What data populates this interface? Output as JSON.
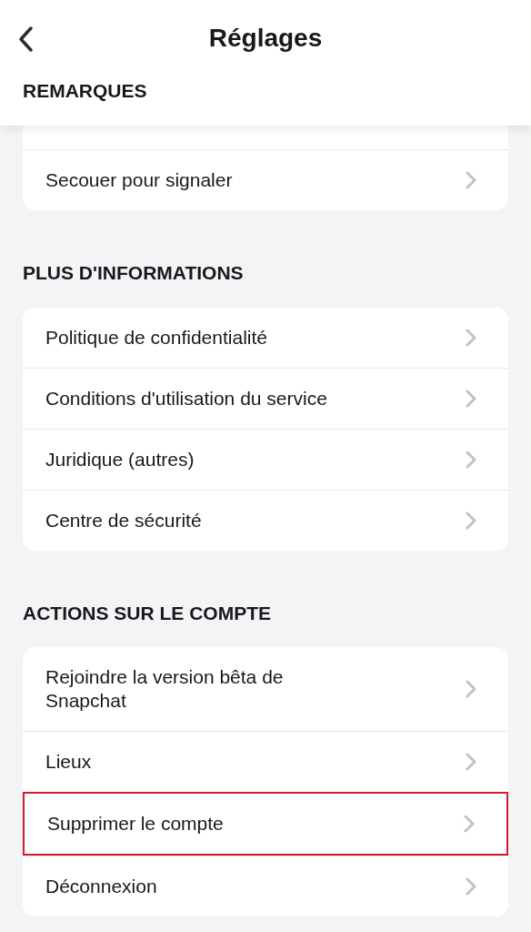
{
  "header": {
    "title": "Réglages"
  },
  "sections": [
    {
      "title": "REMARQUES",
      "rows": [
        {
          "label": "Secouer pour signaler",
          "highlighted": false
        }
      ]
    },
    {
      "title": "PLUS D'INFORMATIONS",
      "rows": [
        {
          "label": "Politique de confidentialité",
          "highlighted": false
        },
        {
          "label": "Conditions d'utilisation du service",
          "highlighted": false
        },
        {
          "label": "Juridique (autres)",
          "highlighted": false
        },
        {
          "label": "Centre de sécurité",
          "highlighted": false
        }
      ]
    },
    {
      "title": "ACTIONS SUR LE COMPTE",
      "rows": [
        {
          "label": "Rejoindre la version bêta de Snapchat",
          "highlighted": false
        },
        {
          "label": "Lieux",
          "highlighted": false
        },
        {
          "label": "Supprimer le compte",
          "highlighted": true
        },
        {
          "label": "Déconnexion",
          "highlighted": false
        }
      ]
    }
  ]
}
